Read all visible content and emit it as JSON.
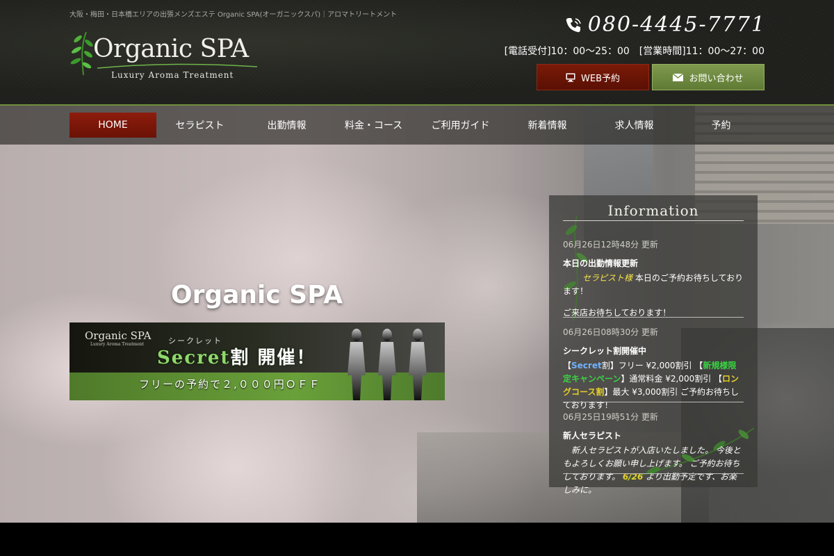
{
  "header": {
    "tagline": "大阪・梅田・日本橋エリアの出張メンズエステ Organic SPA(オーガニックスパ)｜アロマトリートメント",
    "logo_title": "Organic SPA",
    "logo_subtitle": "Luxury Aroma Treatment",
    "phone_icon": "phone-icon",
    "phone_number": "080-4445-7771",
    "hours": "[電話受付]10：00〜25：00　[営業時間]11：00〜27：00",
    "buttons": {
      "web_label": "WEB予約",
      "web_icon": "monitor-icon",
      "contact_label": "お問い合わせ",
      "contact_icon": "mail-icon"
    }
  },
  "nav": {
    "items": [
      {
        "label": "HOME",
        "active": true
      },
      {
        "label": "セラピスト",
        "active": false
      },
      {
        "label": "出勤情報",
        "active": false
      },
      {
        "label": "料金・コース",
        "active": false
      },
      {
        "label": "ご利用ガイド",
        "active": false
      },
      {
        "label": "新着情報",
        "active": false
      },
      {
        "label": "求人情報",
        "active": false
      },
      {
        "label": "予約",
        "active": false
      }
    ]
  },
  "hero": {
    "title": "Organic SPA",
    "banner": {
      "logo": "Organic SPA",
      "logo_subtitle": "Luxury Aroma Treatment",
      "ruby": "シークレット",
      "main_prefix": "Secret",
      "main_suffix": "割 開催！",
      "bottom": "フリーの予約で２,０００円ＯＦＦ"
    }
  },
  "info": {
    "title": "Information",
    "entries": [
      {
        "date": "06月26日12時48分 更新",
        "title": "本日の出勤情報更新",
        "hl": "セラピスト様",
        "body_after": " 本日のご予約お待ちしております！",
        "body2": "ご来店お待ちしております！"
      },
      {
        "date": "06月26日08時30分 更新",
        "title": "シークレット割開催中",
        "p1": "【",
        "secret": "Secret",
        "p2": "割】フリー ¥2,000割引 【",
        "green": "新規様限定キャンペーン",
        "p3": "】通常料金 ¥2,000割引 【",
        "gold": "ロングコース割",
        "p4": "】最大 ¥3,000割引 ご予約お待ちしております！"
      },
      {
        "date": "06月25日19時51分 更新",
        "title": "新人セラピスト",
        "body": "　新人セラピストが入店いたしました。 今後ともよろしくお願い申し上げます。 ご予約お待ちしております。",
        "date_hl": "6/26",
        "body_tail": " より出勤予定です、お楽しみに。"
      }
    ]
  },
  "colors": {
    "nav_active": "#8e1c0c",
    "web_button": "#7a1a08",
    "contact_button": "#7f9a4e",
    "accent_line": "#6f8f3a"
  }
}
